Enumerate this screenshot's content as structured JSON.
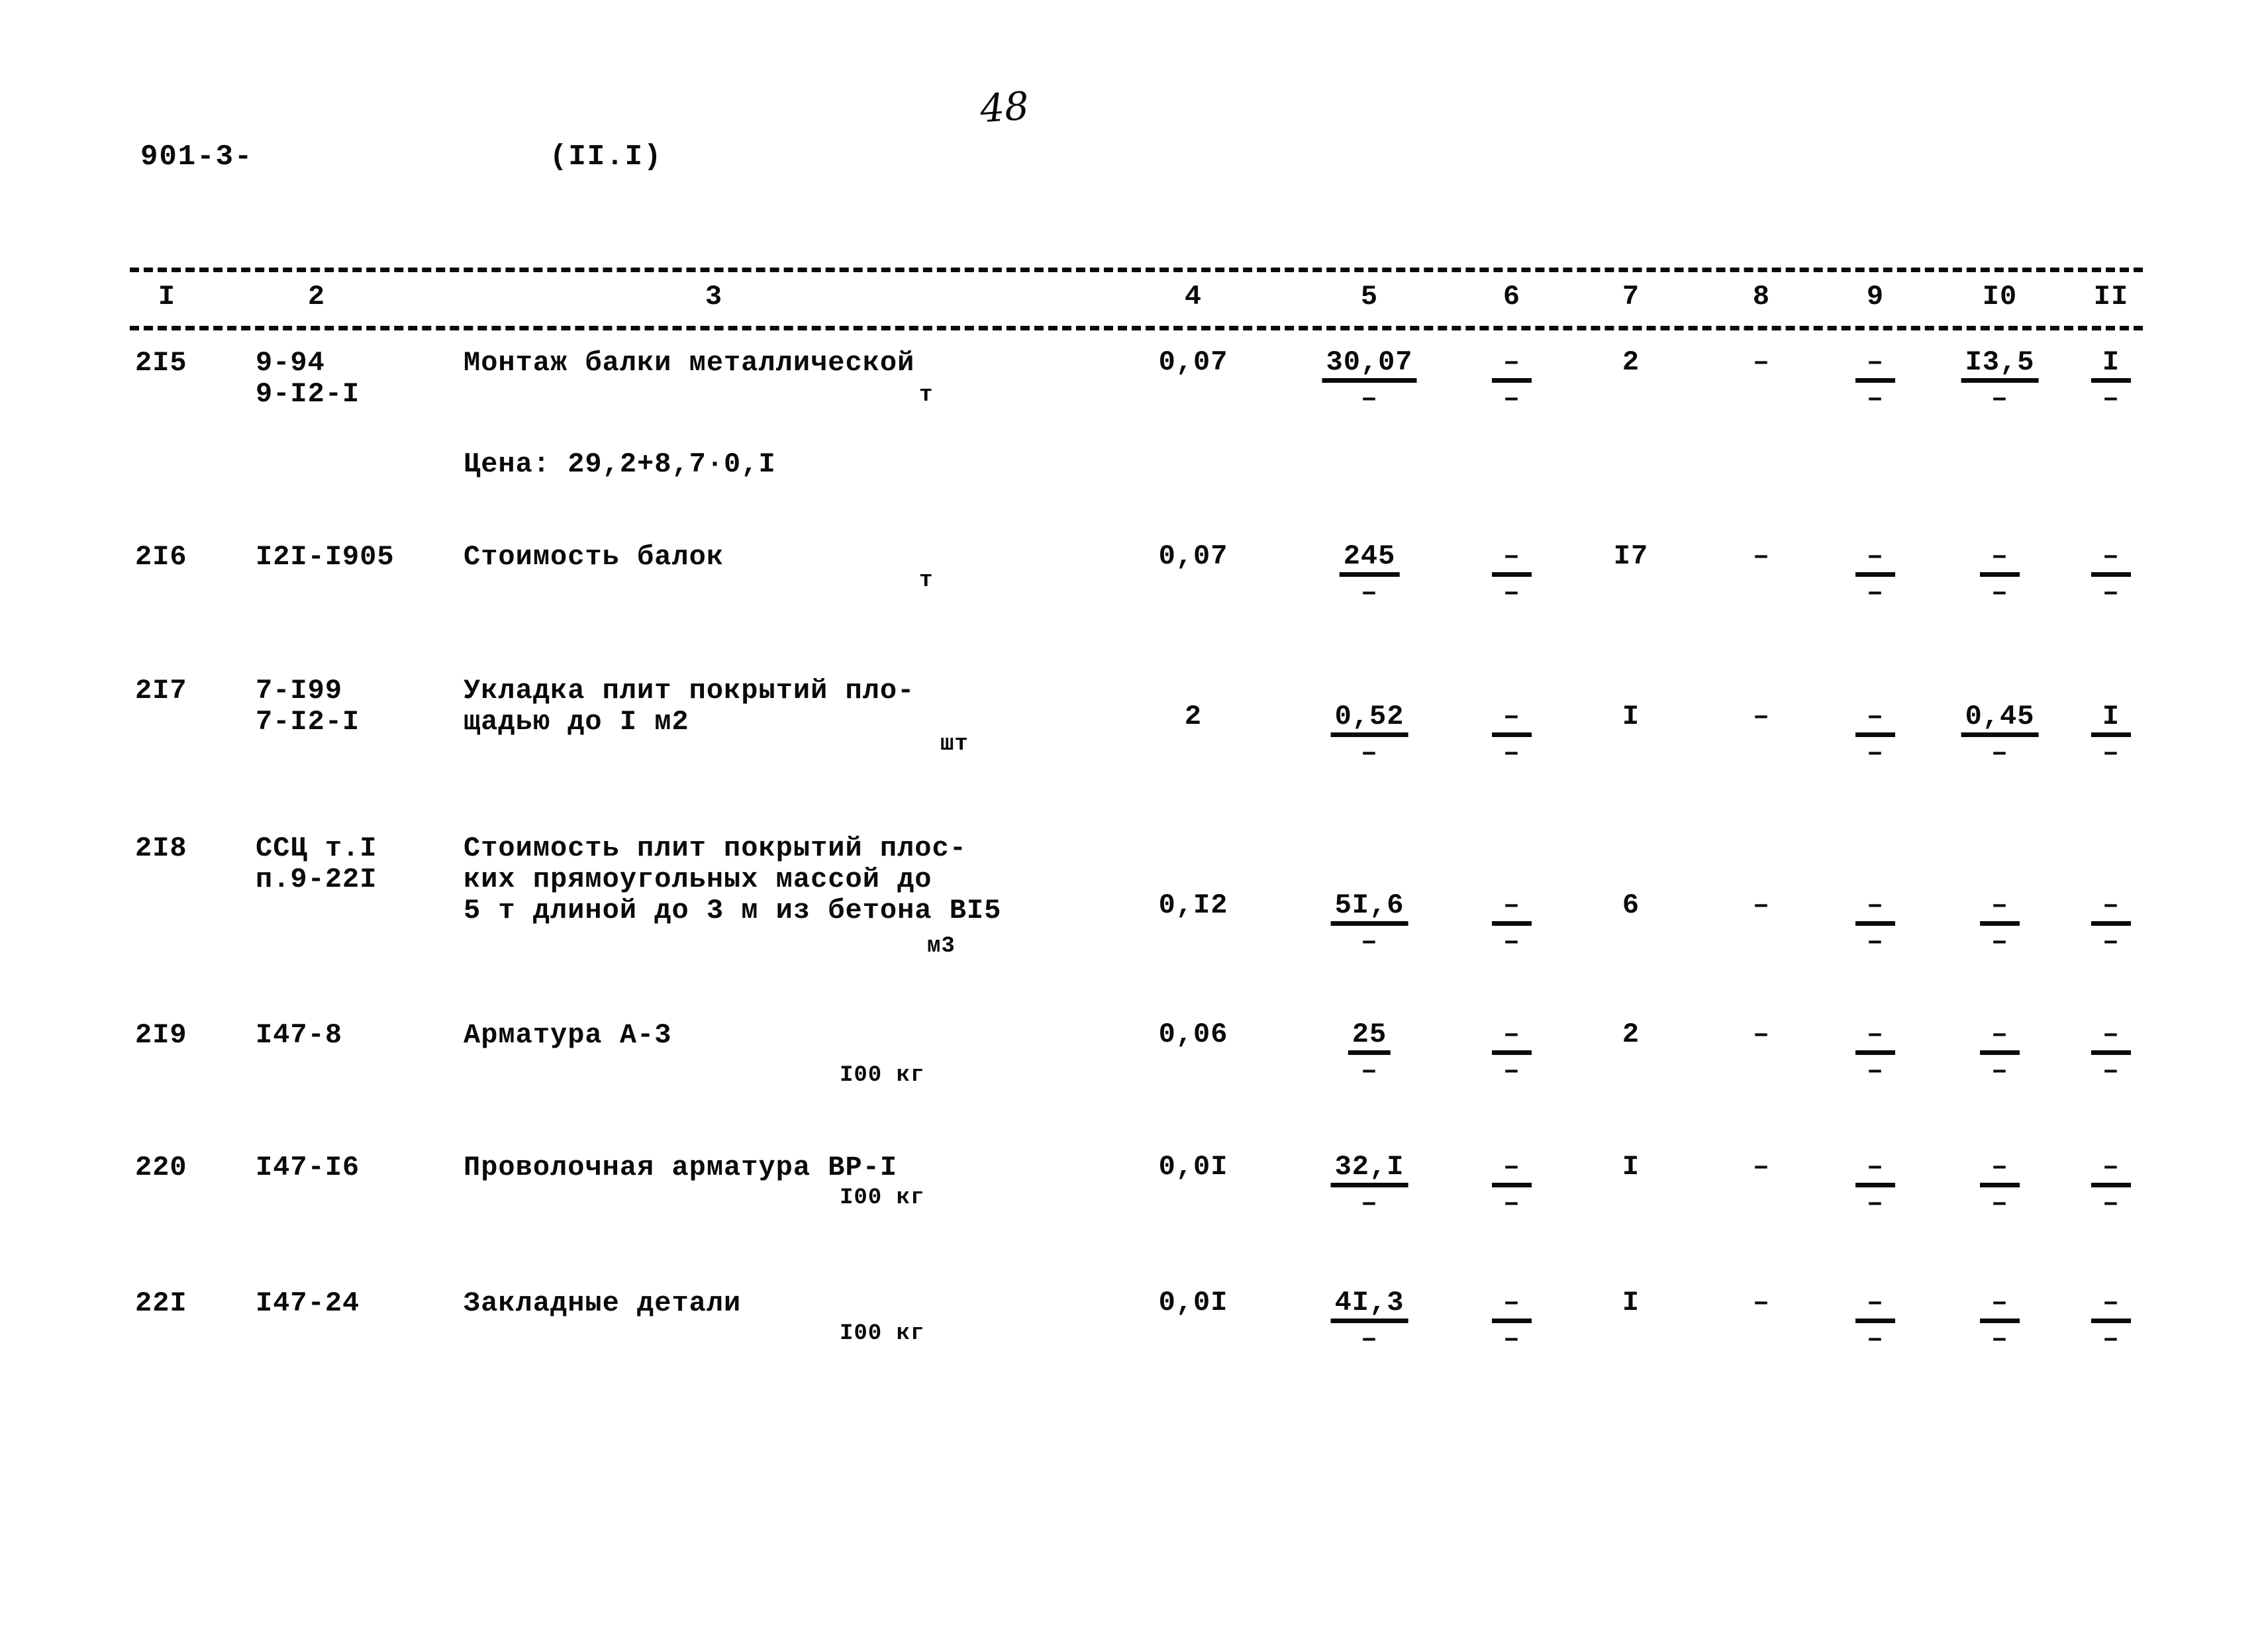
{
  "document": {
    "code": "901-3-",
    "section": "(II.I)",
    "page_number": "48"
  },
  "table": {
    "column_headers": [
      "I",
      "2",
      "3",
      "4",
      "5",
      "6",
      "7",
      "8",
      "9",
      "I0",
      "II"
    ],
    "dash": "–",
    "rows": [
      {
        "num": "2I5",
        "code_lines": [
          "9-94",
          "9-I2-I"
        ],
        "desc_lines": [
          "Монтаж балки металлической"
        ],
        "unit": "т",
        "note": "Цена: 29,2+8,7·0,I",
        "c4": "0,07",
        "c5_top": "30,07",
        "c5_bot": "–",
        "c6_top": "–",
        "c6_bot": "–",
        "c7": "2",
        "c8": "–",
        "c9_top": "–",
        "c9_bot": "–",
        "c10_top": "I3,5",
        "c10_bot": "–",
        "c11_top": "I",
        "c11_bot": "–"
      },
      {
        "num": "2I6",
        "code_lines": [
          "I2I-I905"
        ],
        "desc_lines": [
          "Стоимость балок"
        ],
        "unit": "т",
        "note": "",
        "c4": "0,07",
        "c5_top": "245",
        "c5_bot": "–",
        "c6_top": "–",
        "c6_bot": "–",
        "c7": "I7",
        "c8": "–",
        "c9_top": "–",
        "c9_bot": "–",
        "c10_top": "–",
        "c10_bot": "–",
        "c11_top": "–",
        "c11_bot": "–"
      },
      {
        "num": "2I7",
        "code_lines": [
          "7-I99",
          "7-I2-I"
        ],
        "desc_lines": [
          "Укладка плит покрытий пло-",
          "щадью до I м2"
        ],
        "unit": "шт",
        "note": "",
        "c4": "2",
        "c5_top": "0,52",
        "c5_bot": "–",
        "c6_top": "–",
        "c6_bot": "–",
        "c7": "I",
        "c8": "–",
        "c9_top": "–",
        "c9_bot": "–",
        "c10_top": "0,45",
        "c10_bot": "–",
        "c11_top": "I",
        "c11_bot": "–"
      },
      {
        "num": "2I8",
        "code_lines": [
          "ССЦ т.I",
          "п.9-22I"
        ],
        "desc_lines": [
          "Стоимость плит покрытий плос-",
          "ких прямоугольных массой до",
          "5 т длиной до 3 м из бетона BI5"
        ],
        "unit": "м3",
        "note": "",
        "c4": "0,I2",
        "c5_top": "5I,6",
        "c5_bot": "–",
        "c6_top": "–",
        "c6_bot": "–",
        "c7": "6",
        "c8": "–",
        "c9_top": "–",
        "c9_bot": "–",
        "c10_top": "–",
        "c10_bot": "–",
        "c11_top": "–",
        "c11_bot": "–"
      },
      {
        "num": "2I9",
        "code_lines": [
          "I47-8"
        ],
        "desc_lines": [
          "Арматура А-3"
        ],
        "unit": "I00 кг",
        "note": "",
        "c4": "0,06",
        "c5_top": "25",
        "c5_bot": "–",
        "c6_top": "–",
        "c6_bot": "–",
        "c7": "2",
        "c8": "–",
        "c9_top": "–",
        "c9_bot": "–",
        "c10_top": "–",
        "c10_bot": "–",
        "c11_top": "–",
        "c11_bot": "–"
      },
      {
        "num": "220",
        "code_lines": [
          "I47-I6"
        ],
        "desc_lines": [
          "Проволочная арматура ВР-I"
        ],
        "unit": "I00 кг",
        "note": "",
        "c4": "0,0I",
        "c5_top": "32,I",
        "c5_bot": "–",
        "c6_top": "–",
        "c6_bot": "–",
        "c7": "I",
        "c8": "–",
        "c9_top": "–",
        "c9_bot": "–",
        "c10_top": "–",
        "c10_bot": "–",
        "c11_top": "–",
        "c11_bot": "–"
      },
      {
        "num": "22I",
        "code_lines": [
          "I47-24"
        ],
        "desc_lines": [
          "Закладные детали"
        ],
        "unit": "I00 кг",
        "note": "",
        "c4": "0,0I",
        "c5_top": "4I,3",
        "c5_bot": "–",
        "c6_top": "–",
        "c6_bot": "–",
        "c7": "I",
        "c8": "–",
        "c9_top": "–",
        "c9_bot": "–",
        "c10_top": "–",
        "c10_bot": "–",
        "c11_top": "–",
        "c11_bot": "–"
      }
    ]
  }
}
